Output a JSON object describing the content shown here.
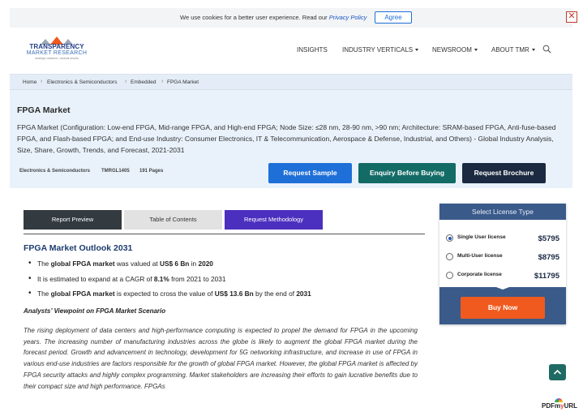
{
  "cookie": {
    "text": "We use cookies for a better user experience. Read our ",
    "link": "Privacy Policy",
    "agree": "Agree",
    "close": "✕"
  },
  "logo": {
    "line1": "TRANSPARENCY",
    "line2": "MARKET RESEARCH",
    "tagline": "strategic research  •  tactical results"
  },
  "nav": {
    "insights": "INSIGHTS",
    "industry": "INDUSTRY VERTICALS",
    "newsroom": "NEWSROOM",
    "about": "ABOUT TMR"
  },
  "breadcrumb": [
    "Home",
    "Electronics & Semiconductors",
    "Embedded",
    "FPGA Market"
  ],
  "report": {
    "title": "FPGA Market",
    "description": "FPGA Market (Configuration: Low-end FPGA, Mid-range FPGA, and High-end FPGA; Node Size: ≤28 nm, 28-90 nm, >90 nm; Architecture: SRAM-based FPGA, Anti-fuse-based FPGA, and Flash-based FPGA; and End-use Industry: Consumer Electronics, IT & Telecommunication, Aerospace & Defense, Industrial, and Others) - Global Industry Analysis, Size, Share, Growth, Trends, and Forecast, 2021-2031",
    "category": "Electronics & Semiconductors",
    "code": "TMRGL1405",
    "pages": "191 Pages"
  },
  "cta": {
    "sample": "Request Sample",
    "enquiry": "Enquiry Before Buying",
    "brochure": "Request Brochure",
    "sample_color": "#1f6fd8",
    "enquiry_color": "#136b66",
    "brochure_color": "#1b2a41"
  },
  "tabs": [
    "Report Preview",
    "Table of Contents",
    "Request Methodology"
  ],
  "outlook": {
    "title": "FPGA Market Outlook 2031",
    "b1": {
      "pre": "The ",
      "bold1": "global FPGA market",
      "mid": " was valued at ",
      "bold2": "US$ 6 Bn",
      "mid2": " in ",
      "bold3": "2020"
    },
    "b2": {
      "pre": "It is estimated to expand at a CAGR of ",
      "bold1": "8.1%",
      "post": " from 2021 to 2031"
    },
    "b3": {
      "pre": "The ",
      "bold1": "global FPGA market",
      "mid": " is expected to cross the value of ",
      "bold2": "US$ 13.6 Bn",
      "mid2": " by the end of ",
      "bold3": "2031"
    }
  },
  "analyst": {
    "heading": "Analysts’ Viewpoint on FPGA Market Scenario",
    "paragraph": "The rising deployment of data centers and high-performance computing is expected to propel the demand for FPGA in the upcoming years. The increasing number of manufacturing industries across the globe is likely to augment the global FPGA market during the forecast period. Growth and advancement in technology, development for 5G networking infrastructure, and increase in use of FPGA in various end-use industries are factors responsible for the growth of global FPGA market. However, the global FPGA market is affected by FPGA security attacks and highly complex programming. Market stakeholders are increasing their efforts to gain lucrative benefits due to their compact size and high performance. FPGAs"
  },
  "license": {
    "header": "Select License Type",
    "options": [
      {
        "name": "Single User license",
        "price": "$5795",
        "selected": true
      },
      {
        "name": "Multi-User license",
        "price": "$8795",
        "selected": false
      },
      {
        "name": "Corporate license",
        "price": "$11795",
        "selected": false
      }
    ],
    "buy": "Buy Now"
  },
  "watermark": {
    "pre": "PDFm",
    "accent": "y",
    "post": "URL"
  }
}
